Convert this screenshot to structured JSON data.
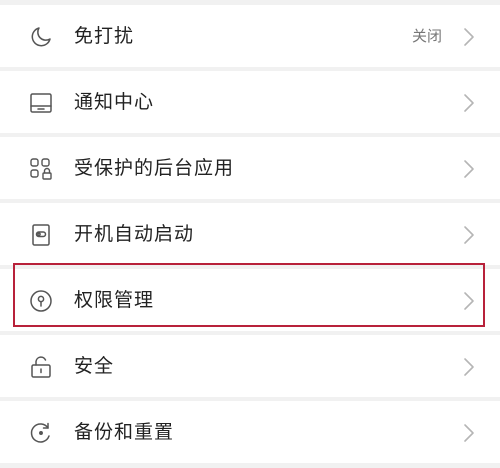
{
  "settings": {
    "items": [
      {
        "label": "免打扰",
        "value": "关闭",
        "icon": "moon-icon"
      },
      {
        "label": "通知中心",
        "icon": "notification-tray-icon"
      },
      {
        "label": "受保护的后台应用",
        "icon": "protected-apps-icon"
      },
      {
        "label": "开机自动启动",
        "icon": "auto-start-icon"
      },
      {
        "label": "权限管理",
        "icon": "permission-lock-circle-icon"
      },
      {
        "label": "安全",
        "icon": "padlock-icon"
      },
      {
        "label": "备份和重置",
        "icon": "backup-reset-icon"
      }
    ]
  },
  "highlight": {
    "target": "权限管理",
    "color": "#b8213a"
  }
}
